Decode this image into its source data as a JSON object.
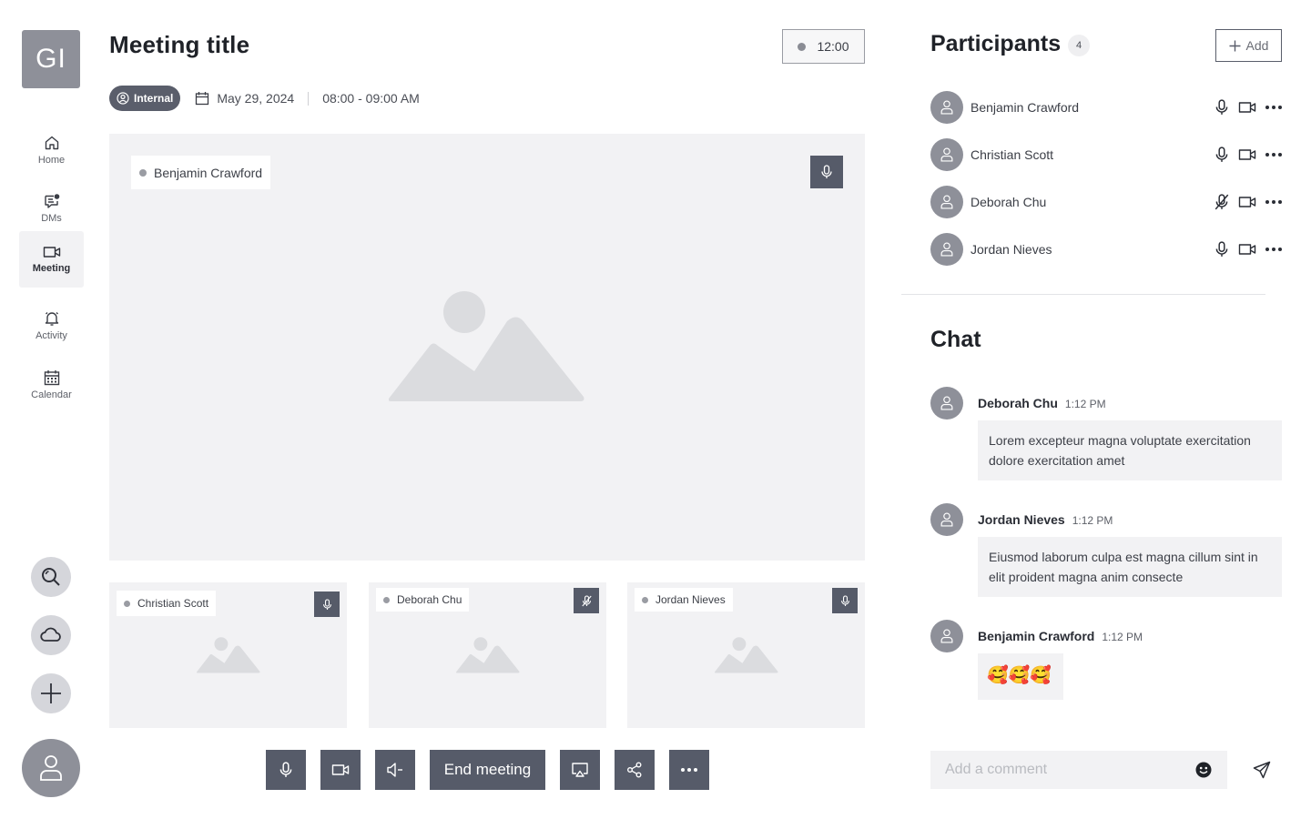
{
  "app": {
    "logo_text": "GI"
  },
  "nav": {
    "items": [
      {
        "label": "Home",
        "icon": "home-icon"
      },
      {
        "label": "DMs",
        "icon": "chat-icon"
      },
      {
        "label": "Meeting",
        "icon": "video-icon",
        "active": true
      },
      {
        "label": "Activity",
        "icon": "bell-icon"
      },
      {
        "label": "Calendar",
        "icon": "calendar-icon"
      }
    ],
    "bottom": [
      "search-icon",
      "cloud-icon",
      "plus-icon",
      "user-icon"
    ]
  },
  "meeting": {
    "title": "Meeting title",
    "timer": "12:00",
    "badge": "Internal",
    "date": "May 29, 2024",
    "time_range": "08:00 - 09:00 AM",
    "main_speaker": "Benjamin Crawford",
    "thumbnails": [
      {
        "name": "Christian Scott",
        "muted": false
      },
      {
        "name": "Deborah Chu",
        "muted": true
      },
      {
        "name": "Jordan Nieves",
        "muted": false
      }
    ],
    "end_label": "End meeting"
  },
  "participants": {
    "title": "Participants",
    "count": "4",
    "add_label": "Add",
    "list": [
      {
        "name": "Benjamin Crawford",
        "muted": false
      },
      {
        "name": "Christian Scott",
        "muted": false
      },
      {
        "name": "Deborah Chu",
        "muted": true
      },
      {
        "name": "Jordan Nieves",
        "muted": false
      }
    ]
  },
  "chat": {
    "title": "Chat",
    "messages": [
      {
        "author": "Deborah Chu",
        "time": "1:12 PM",
        "text": "Lorem excepteur magna voluptate exercitation dolore exercitation amet"
      },
      {
        "author": "Jordan Nieves",
        "time": "1:12 PM",
        "text": "Eiusmod laborum culpa est magna cillum sint in elit proident magna anim consecte"
      },
      {
        "author": "Benjamin Crawford",
        "time": "1:12 PM",
        "text": "🥰🥰🥰"
      }
    ],
    "input_placeholder": "Add a comment"
  },
  "colors": {
    "control": "#565b69",
    "avatar": "#8e9099",
    "panel": "#f2f2f4",
    "badge": "#5a5e6b"
  }
}
